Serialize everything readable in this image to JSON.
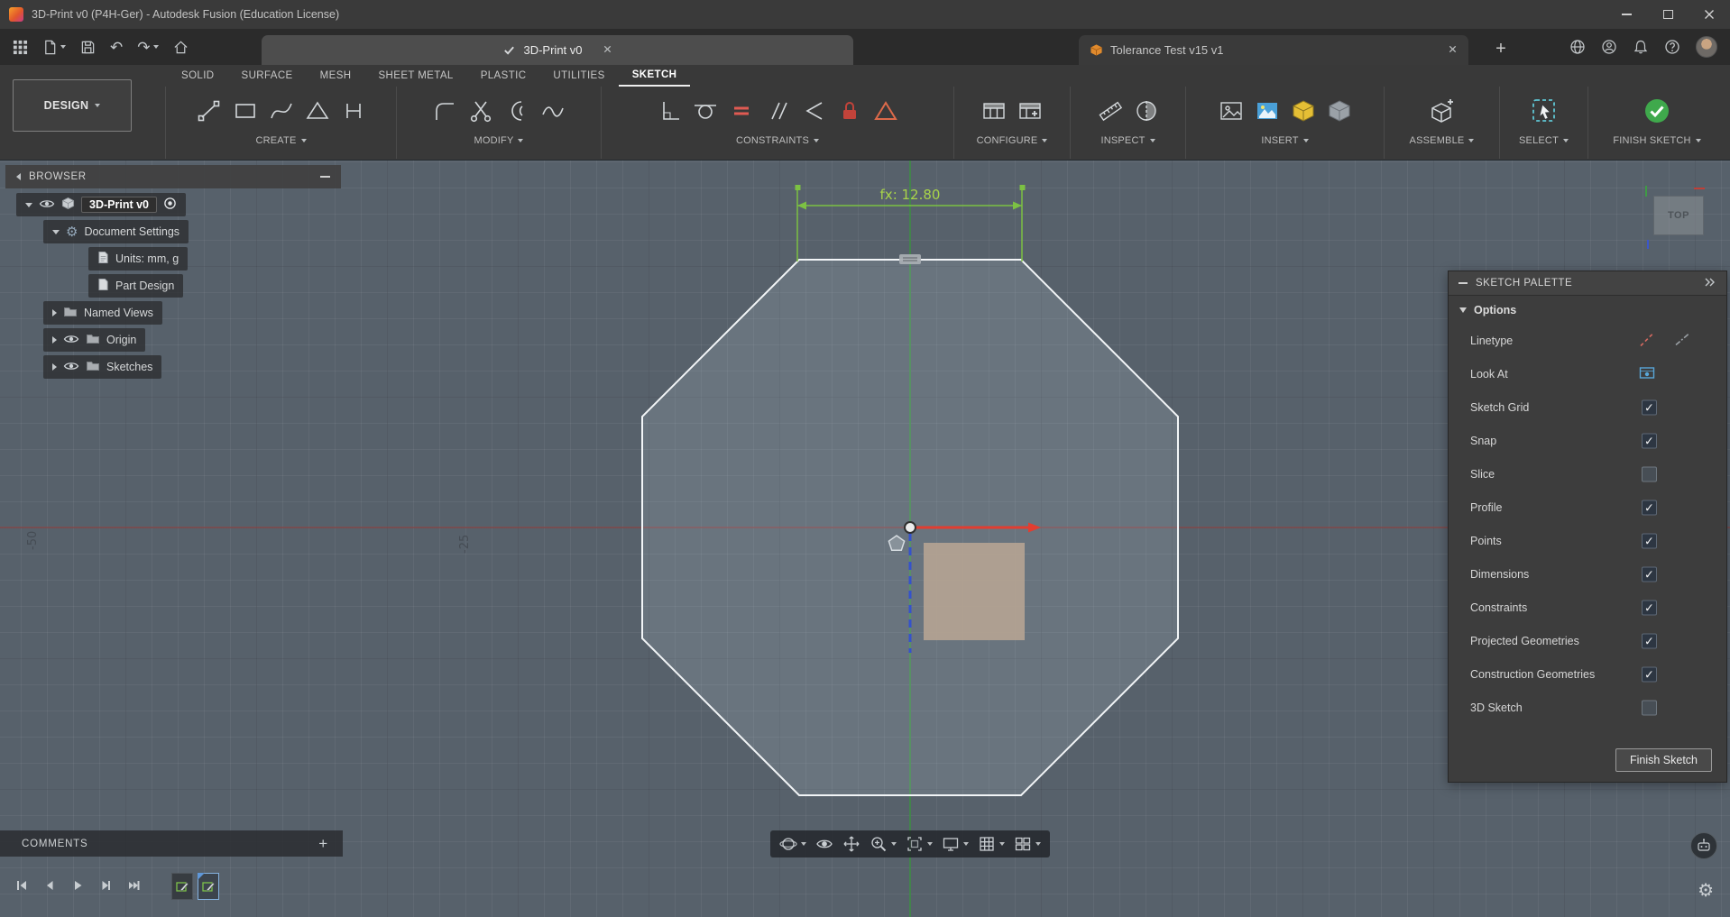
{
  "title_bar": {
    "title": "3D-Print v0 (P4H-Ger) - Autodesk Fusion (Education License)"
  },
  "docbar": {
    "tabs": [
      {
        "label": "3D-Print v0"
      },
      {
        "label": "Tolerance Test v15 v1"
      }
    ],
    "new_tab": "+"
  },
  "ribbon": {
    "workspace": "DESIGN",
    "tabs": [
      {
        "label": "SOLID"
      },
      {
        "label": "SURFACE"
      },
      {
        "label": "MESH"
      },
      {
        "label": "SHEET METAL"
      },
      {
        "label": "PLASTIC"
      },
      {
        "label": "UTILITIES"
      },
      {
        "label": "SKETCH"
      }
    ],
    "groups": [
      {
        "label": "CREATE"
      },
      {
        "label": "MODIFY"
      },
      {
        "label": "CONSTRAINTS"
      },
      {
        "label": "CONFIGURE"
      },
      {
        "label": "INSPECT"
      },
      {
        "label": "INSERT"
      },
      {
        "label": "ASSEMBLE"
      },
      {
        "label": "SELECT"
      },
      {
        "label": "FINISH SKETCH"
      }
    ]
  },
  "browser": {
    "title": "BROWSER",
    "root_label": "3D-Print v0",
    "items": [
      {
        "label": "Document Settings"
      },
      {
        "label": "Units: mm, g"
      },
      {
        "label": "Part Design"
      },
      {
        "label": "Named Views"
      },
      {
        "label": "Origin"
      },
      {
        "label": "Sketches"
      }
    ]
  },
  "canvas": {
    "dimension_label": "fx: 12.80",
    "axis_labels": {
      "first": "-50",
      "second": "-25"
    },
    "viewcube_label": "TOP"
  },
  "sketch_palette": {
    "title": "SKETCH PALETTE",
    "options_label": "Options",
    "rows": [
      {
        "label": "Linetype"
      },
      {
        "label": "Look At"
      },
      {
        "label": "Sketch Grid",
        "check": "✓"
      },
      {
        "label": "Snap",
        "check": "✓"
      },
      {
        "label": "Slice",
        "check": ""
      },
      {
        "label": "Profile",
        "check": "✓"
      },
      {
        "label": "Points",
        "check": "✓"
      },
      {
        "label": "Dimensions",
        "check": "✓"
      },
      {
        "label": "Constraints",
        "check": "✓"
      },
      {
        "label": "Projected Geometries",
        "check": "✓"
      },
      {
        "label": "Construction Geometries",
        "check": "✓"
      },
      {
        "label": "3D Sketch",
        "check": ""
      }
    ],
    "finish_button": "Finish Sketch"
  },
  "comments": {
    "label": "COMMENTS",
    "add_label": "+"
  }
}
